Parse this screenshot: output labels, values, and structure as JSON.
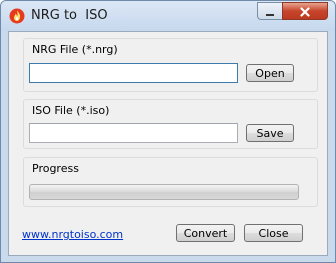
{
  "window": {
    "title": "NRG to  ISO"
  },
  "nrg_group": {
    "label": "NRG File (*.nrg)",
    "value": "",
    "button_label": "Open"
  },
  "iso_group": {
    "label": "ISO File (*.iso)",
    "value": "",
    "button_label": "Save"
  },
  "progress_group": {
    "label": "Progress",
    "value": 0
  },
  "footer": {
    "link_text": "www.nrgtoiso.com",
    "convert_label": "Convert",
    "close_label": "Close"
  },
  "icons": {
    "app": "flame-icon",
    "minimize": "minimize-icon",
    "close": "close-icon"
  },
  "colors": {
    "link": "#0033cc",
    "close_button": "#c7452c",
    "titlebar": "#c6d8ee"
  }
}
